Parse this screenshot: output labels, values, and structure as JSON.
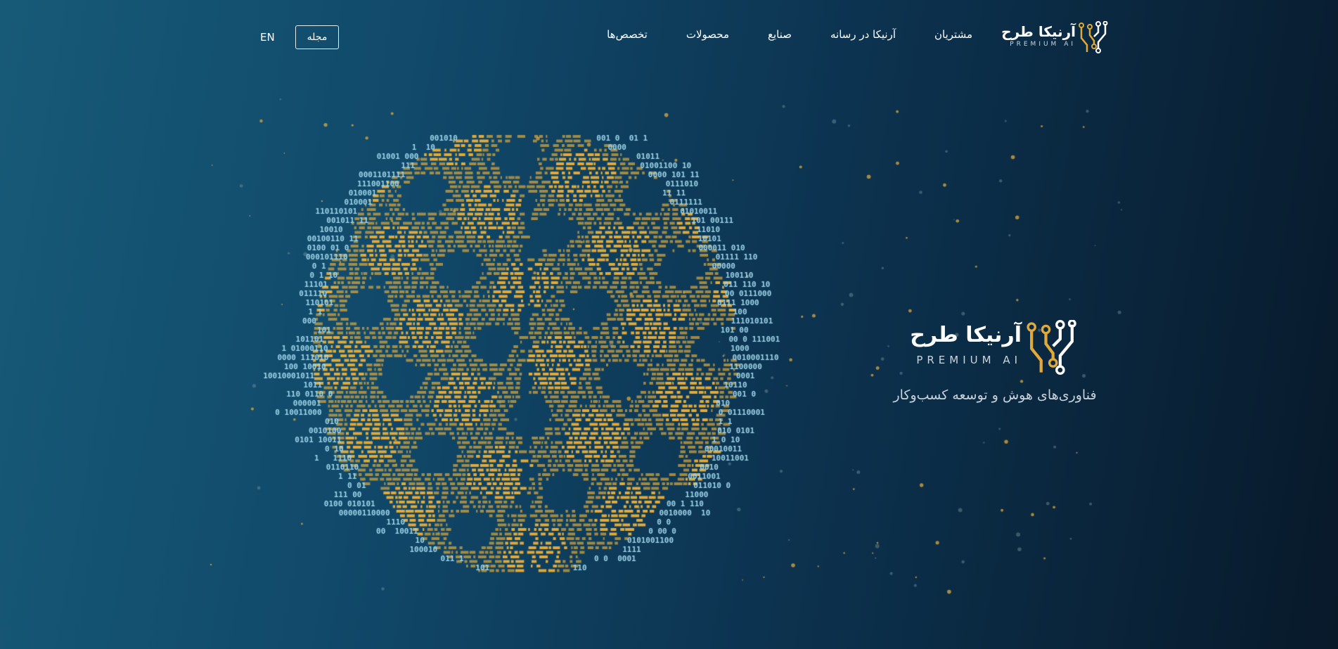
{
  "header": {
    "logo": {
      "name_fa": "آرنیکا طرح",
      "name_en": "PREMIUM AI"
    },
    "nav_items": [
      {
        "label": "تخصص‌ها",
        "id": "specialties"
      },
      {
        "label": "محصولات",
        "id": "products"
      },
      {
        "label": "صنایع",
        "id": "industries"
      },
      {
        "label": "آرنیکا در رسانه",
        "id": "media"
      },
      {
        "label": "مشتریان",
        "id": "customers"
      }
    ],
    "magazine_label": "مجله",
    "language_label": "EN"
  },
  "hero": {
    "logo": {
      "name_fa": "آرنیکا طرح",
      "name_en": "PREMIUM AI"
    },
    "tagline": "فناوری‌های هوش و توسعه کسب‌وکار"
  },
  "colors": {
    "accent_gold": "#e0a93a",
    "binary_text": "#9fd6ea",
    "background_start": "#175a78",
    "background_end": "#08192a"
  },
  "icons": {
    "logo_mark": "circuit-brain-icon"
  }
}
